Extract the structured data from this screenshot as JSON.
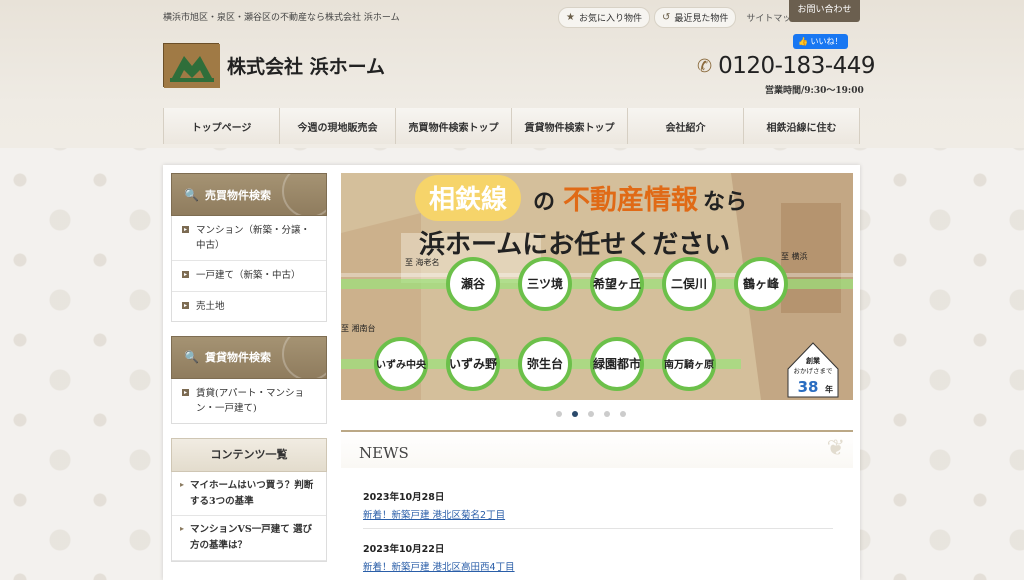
{
  "header": {
    "tagline": "横浜市旭区・泉区・瀬谷区の不動産なら株式会社 浜ホーム",
    "favorites_label": "お気に入り物件",
    "recent_label": "最近見た物件",
    "sitemap_label": "サイトマップ",
    "contact_label": "お問い合わせ",
    "company_name": "株式会社 浜ホーム",
    "fb_like_label": "いいね！",
    "phone_number": "0120-183-449",
    "hours": "営業時間/9:30〜19:00"
  },
  "nav": {
    "items": [
      {
        "label": "トップページ"
      },
      {
        "label": "今週の現地販売会"
      },
      {
        "label": "売買物件検索トップ"
      },
      {
        "label": "賃貸物件検索トップ"
      },
      {
        "label": "会社紹介"
      },
      {
        "label": "相鉄沿線に住む"
      }
    ]
  },
  "sidebar": {
    "sale_heading": "売買物件検索",
    "sale_items": [
      {
        "label": "マンション（新築・分譲・中古）"
      },
      {
        "label": "一戸建て（新築・中古）"
      },
      {
        "label": "売土地"
      }
    ],
    "rent_heading": "賃貸物件検索",
    "rent_items": [
      {
        "label": "賃貸(アパート・マンション・一戸建て)"
      }
    ],
    "contents_heading": "コンテンツ一覧",
    "contents_items": [
      {
        "label": "マイホームはいつ買う？判断する3つの基準"
      },
      {
        "label": "マンションVS一戸建て 選び方の基準は？"
      }
    ]
  },
  "banner": {
    "line_name": "相鉄線",
    "of": "の",
    "info": "不動産情報",
    "nara": "なら",
    "line2": "浜ホームにお任せください",
    "to_ebina": "至 海老名",
    "to_yokohama": "至 横浜",
    "to_shonandai": "至 湘南台",
    "stations_top": [
      "瀬谷",
      "三ツ境",
      "希望ヶ丘",
      "二俣川",
      "鶴ヶ峰"
    ],
    "stations_bottom": [
      "いずみ中央",
      "いずみ野",
      "弥生台",
      "緑園都市",
      "南万騎ヶ原"
    ],
    "badge_top": "創業",
    "badge_mid": "おかげさまで",
    "badge_years": "38",
    "badge_unit": "年"
  },
  "slider": {
    "count": 5,
    "active": 2
  },
  "news": {
    "heading": "NEWS",
    "items": [
      {
        "date": "2023年10月28日",
        "title": "新着！新築戸建 港北区菊名2丁目"
      },
      {
        "date": "2023年10月22日",
        "title": "新着！新築戸建 港北区高田西4丁目"
      }
    ]
  },
  "colors": {
    "accent_brown": "#8f7c5e",
    "contact_button": "#6b5f4f",
    "station_green": "#6cc04a",
    "link_blue": "#2a5ea8",
    "dot_active": "#2b4a6b"
  }
}
